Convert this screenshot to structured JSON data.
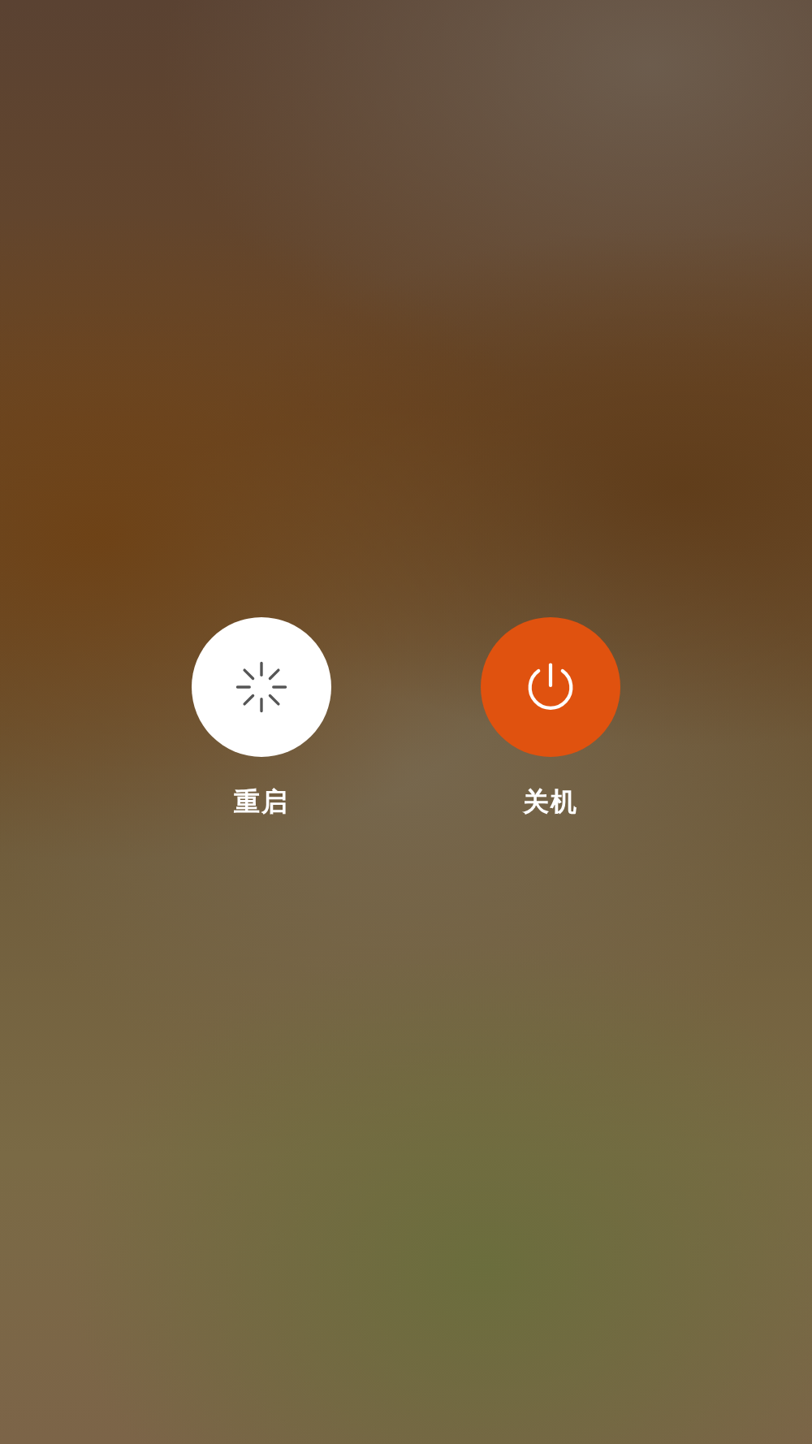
{
  "actions": [
    {
      "kind": "restart",
      "label": "重启"
    },
    {
      "kind": "power",
      "label": "关机"
    }
  ]
}
